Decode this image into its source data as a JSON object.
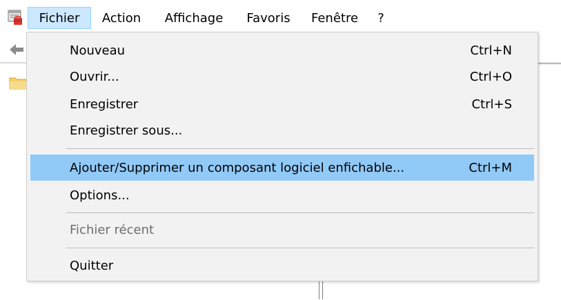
{
  "menubar": {
    "items": [
      {
        "label": "Fichier"
      },
      {
        "label": "Action"
      },
      {
        "label": "Affichage"
      },
      {
        "label": "Favoris"
      },
      {
        "label": "Fenêtre"
      },
      {
        "label": "?"
      }
    ]
  },
  "file_menu": {
    "items": [
      {
        "label": "Nouveau",
        "shortcut": "Ctrl+N"
      },
      {
        "label": "Ouvrir...",
        "shortcut": "Ctrl+O"
      },
      {
        "label": "Enregistrer",
        "shortcut": "Ctrl+S"
      },
      {
        "label": "Enregistrer sous..."
      },
      {
        "label": "Ajouter/Supprimer un composant logiciel enfichable...",
        "shortcut": "Ctrl+M"
      },
      {
        "label": "Options..."
      },
      {
        "label": "Fichier récent"
      },
      {
        "label": "Quitter"
      }
    ]
  },
  "colors": {
    "menu_active_bg": "#cce8ff",
    "highlight_bg": "#91c9f7",
    "menu_bg": "#f2f2f2",
    "disabled_text": "#6d6d6d"
  },
  "icons": {
    "app": "mmc-console-icon",
    "back": "back-arrow-icon",
    "tree": "folder-icon"
  }
}
